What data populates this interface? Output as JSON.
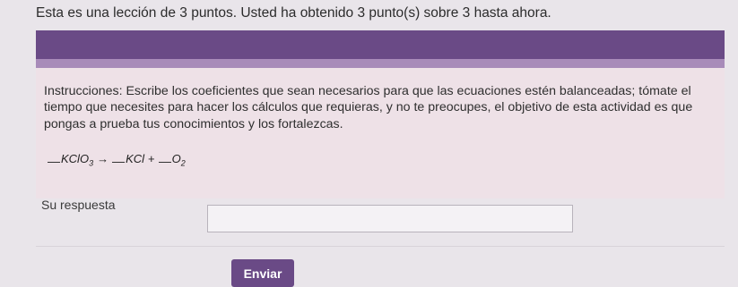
{
  "lesson": {
    "status": "Esta es una lección de 3 puntos. Usted ha obtenido 3 punto(s) sobre 3 hasta ahora."
  },
  "question": {
    "instructions": "Instrucciones: Escribe los coeficientes que sean necesarios para que las ecuaciones estén balanceadas; tómate el tiempo que necesites para hacer los cálculos que requieras, y no te preocupes, el objetivo de esta actividad es que pongas a prueba tus conocimientos y los fortalezcas.",
    "equation": {
      "reactant_base": "KClO",
      "reactant_sub": "3",
      "arrow": "→",
      "product1": "KCl",
      "plus": "+",
      "product2_base": "O",
      "product2_sub": "2"
    }
  },
  "answer": {
    "label": "Su respuesta",
    "value": "",
    "placeholder": ""
  },
  "submit": {
    "label": "Enviar"
  },
  "colors": {
    "header": "#6a4a86",
    "header_stripe": "#a88bb9",
    "card_background": "#eee1e7",
    "button": "#6a4a86"
  }
}
